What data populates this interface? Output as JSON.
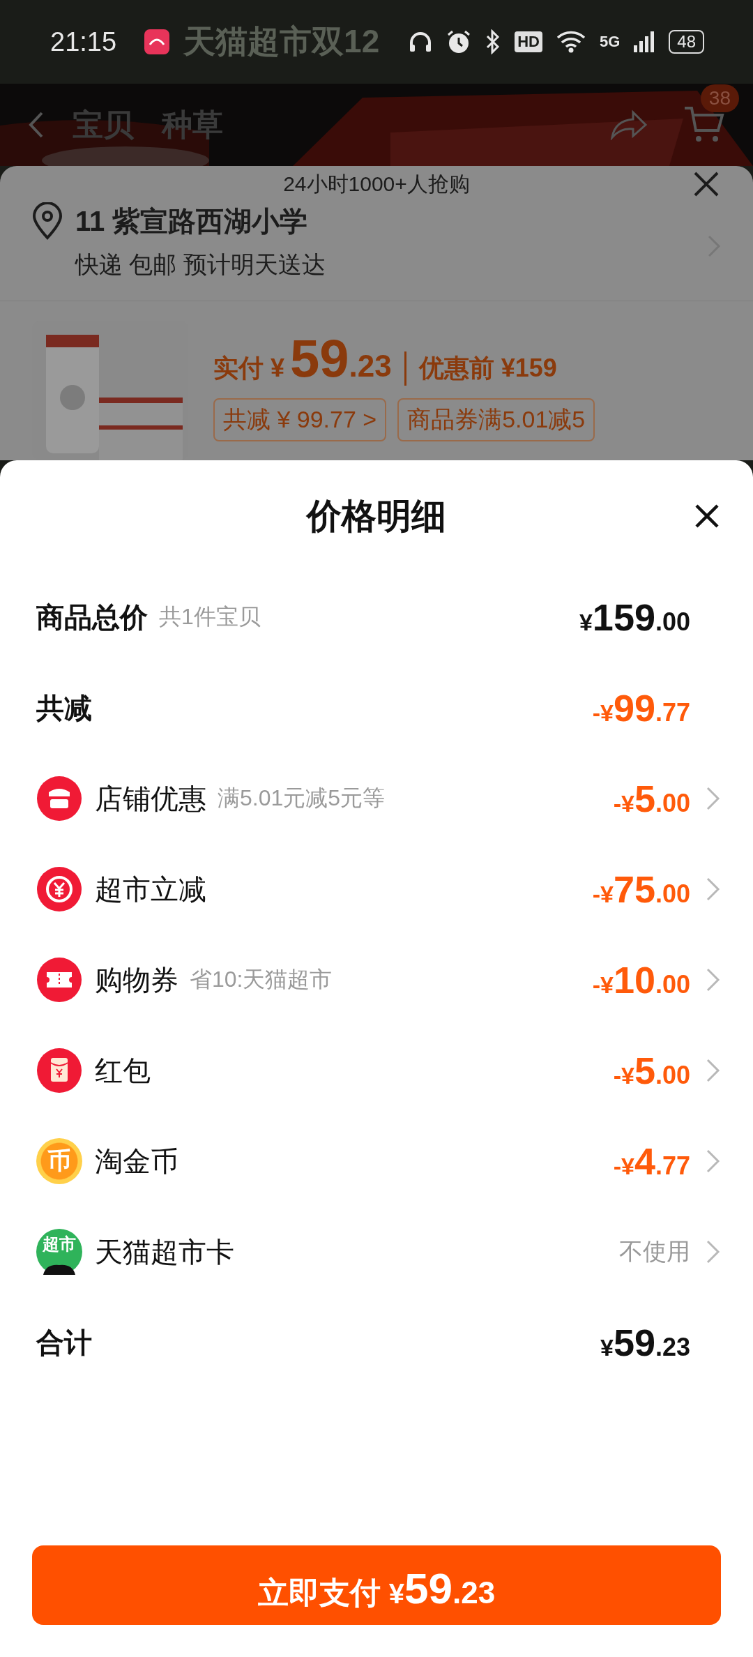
{
  "status_bar": {
    "time": "21:15",
    "banner": "天猫超市双12",
    "hd": "HD",
    "network": "5G",
    "battery": "48"
  },
  "header": {
    "tabs": [
      {
        "label": "宝贝",
        "selected": false
      },
      {
        "label": "种草",
        "selected": false
      }
    ],
    "cart_badge": "38"
  },
  "order_sheet": {
    "notice": "24小时1000+人抢购",
    "address": {
      "title": "11 紫宣路西湖小学",
      "detail": "快递 包邮 预计明天送达"
    },
    "product": {
      "paid_label": "实付 ¥",
      "paid_main": "59",
      "paid_fraction": ".23",
      "original": "优惠前 ¥159",
      "tags": [
        "共减 ¥ 99.77 >",
        "商品券满5.01减5"
      ]
    }
  },
  "price_detail": {
    "title": "价格明细",
    "rows": [
      {
        "kind": "summary",
        "label": "商品总价",
        "note": "共1件宝贝",
        "prefix": "¥",
        "main": "159",
        "fraction": ".00"
      },
      {
        "kind": "discount_summary",
        "label": "共减",
        "prefix": "-¥",
        "main": "99",
        "fraction": ".77"
      },
      {
        "kind": "store",
        "label": "店铺优惠",
        "note": "满5.01元减5元等",
        "prefix": "-¥",
        "main": "5",
        "fraction": ".00"
      },
      {
        "kind": "cashback",
        "label": "超市立减",
        "prefix": "-¥",
        "main": "75",
        "fraction": ".00"
      },
      {
        "kind": "ticket",
        "label": "购物券",
        "note": "省10:天猫超市",
        "prefix": "-¥",
        "main": "10",
        "fraction": ".00"
      },
      {
        "kind": "envelope",
        "label": "红包",
        "prefix": "-¥",
        "main": "5",
        "fraction": ".00"
      },
      {
        "kind": "coin",
        "icon_text": "币",
        "label": "淘金币",
        "prefix": "-¥",
        "main": "4",
        "fraction": ".77"
      },
      {
        "kind": "card",
        "icon_text": "超市",
        "label": "天猫超市卡",
        "value": "不使用"
      },
      {
        "kind": "summary",
        "label": "合计",
        "prefix": "¥",
        "main": "59",
        "fraction": ".23"
      }
    ],
    "pay_button": {
      "label": "立即支付",
      "prefix": "¥",
      "main": "59",
      "fraction": ".23"
    }
  }
}
